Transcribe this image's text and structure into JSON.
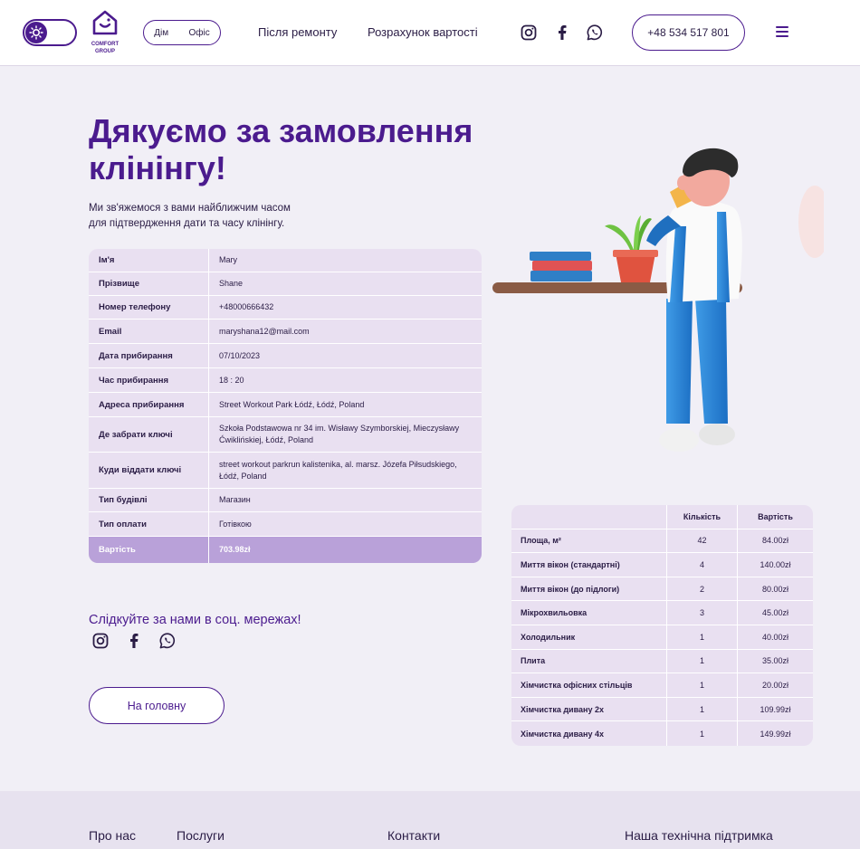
{
  "header": {
    "logo_line1": "COMFORT",
    "logo_line2": "GROUP",
    "seg_home": "Дім",
    "seg_office": "Офіс",
    "nav": [
      "Після ремонту",
      "Розрахунок вартості"
    ],
    "phone": "+48 534 517 801"
  },
  "hero": {
    "title": "Дякуємо за замовлення клінінгу!",
    "subtitle_line1": "Ми зв'яжемося з вами найближчим часом",
    "subtitle_line2": "для підтвердження дати та часу клінінгу."
  },
  "order": {
    "rows": [
      {
        "label": "Ім'я",
        "value": "Mary"
      },
      {
        "label": "Прізвище",
        "value": "Shane"
      },
      {
        "label": "Номер телефону",
        "value": "+48000666432"
      },
      {
        "label": "Email",
        "value": "maryshana12@mail.com"
      },
      {
        "label": "Дата прибирання",
        "value": "07/10/2023"
      },
      {
        "label": "Час прибирання",
        "value": "18 : 20"
      },
      {
        "label": "Адреса прибирання",
        "value": "Street Workout Park Łódź, Łódź, Poland"
      },
      {
        "label": "Де забрати ключі",
        "value": "Szkoła Podstawowa nr 34 im. Wisławy Szymborskiej, Mieczysławy Ćwiklińskiej, Łódź, Poland"
      },
      {
        "label": "Куди віддати ключі",
        "value": "street workout parkrun kalistenika, al. marsz. Józefa Piłsudskiego, Łódź, Poland"
      },
      {
        "label": "Тип будівлі",
        "value": "Магазин"
      },
      {
        "label": "Тип оплати",
        "value": "Готівкою"
      }
    ],
    "total_label": "Вартість",
    "total_value": "703.98zł"
  },
  "services": {
    "col_qty": "Кількість",
    "col_price": "Вартість",
    "rows": [
      {
        "name": "Площа, м²",
        "qty": "42",
        "price": "84.00zł"
      },
      {
        "name": "Миття вікон (стандартні)",
        "qty": "4",
        "price": "140.00zł"
      },
      {
        "name": "Миття вікон (до підлоги)",
        "qty": "2",
        "price": "80.00zł"
      },
      {
        "name": "Мікрохвильовка",
        "qty": "3",
        "price": "45.00zł"
      },
      {
        "name": "Холодильник",
        "qty": "1",
        "price": "40.00zł"
      },
      {
        "name": "Плита",
        "qty": "1",
        "price": "35.00zł"
      },
      {
        "name": "Хімчистка офісних стільців",
        "qty": "1",
        "price": "20.00zł"
      },
      {
        "name": "Хімчистка дивану 2х",
        "qty": "1",
        "price": "109.99zł"
      },
      {
        "name": "Хімчистка дивану 4х",
        "qty": "1",
        "price": "149.99zł"
      }
    ]
  },
  "follow": {
    "title": "Слідкуйте за нами в соц. мережах!",
    "home_button": "На головну"
  },
  "footer": {
    "links": [
      "Про нас",
      "Послуги",
      "Контакти",
      "Наша технічна підтримка"
    ]
  },
  "colors": {
    "brand": "#4b1b8e",
    "table_bg": "#e9e0f1",
    "total_bg": "#b9a1d9",
    "page_bg": "#f1eff6"
  },
  "icons": [
    "sun-icon",
    "house-logo-icon",
    "instagram-icon",
    "facebook-icon",
    "whatsapp-icon",
    "menu-icon"
  ]
}
